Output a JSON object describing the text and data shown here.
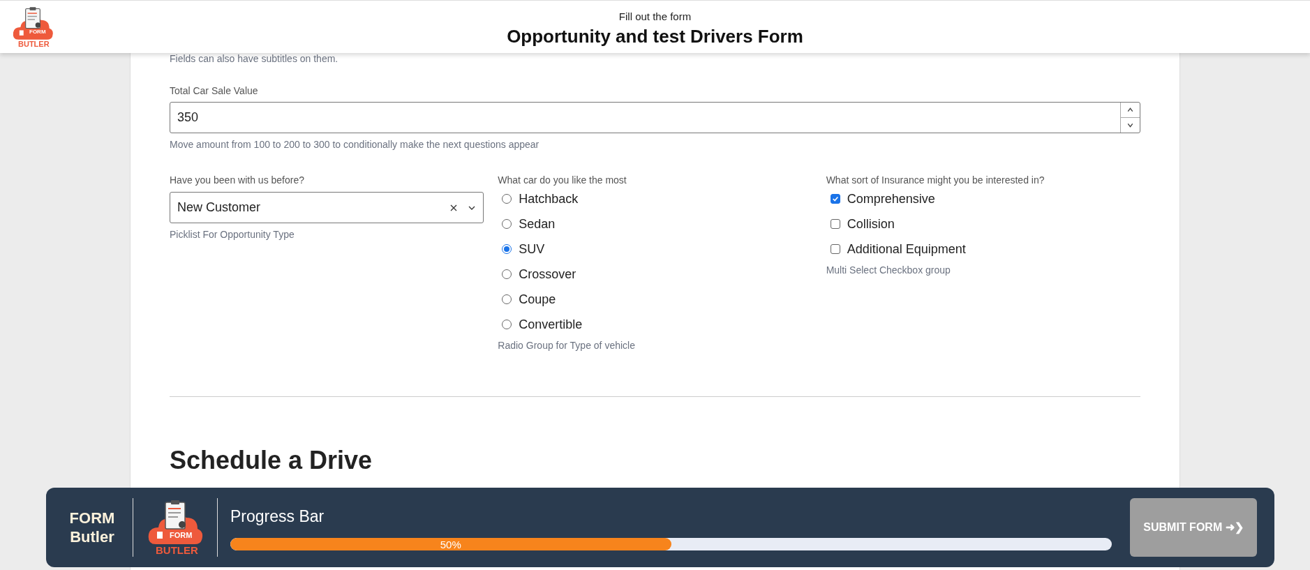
{
  "header": {
    "logo": {
      "word_top": "FORM",
      "word_bottom": "BUTLER"
    },
    "subtitle": "Fill out the form",
    "title": "Opportunity and test Drivers Form"
  },
  "form": {
    "intro_note": "Fields can also have subtitles on them.",
    "sale_value": {
      "label": "Total Car Sale Value",
      "value": "350",
      "help": "Move amount from 100 to 200 to 300 to conditionally make the next questions appear"
    },
    "customer": {
      "label": "Have you been with us before?",
      "value": "New Customer",
      "help": "Picklist For Opportunity Type"
    },
    "car": {
      "label": "What car do you like the most",
      "help": "Radio Group for Type of vehicle",
      "options": [
        {
          "label": "Hatchback",
          "selected": false
        },
        {
          "label": "Sedan",
          "selected": false
        },
        {
          "label": "SUV",
          "selected": true
        },
        {
          "label": "Crossover",
          "selected": false
        },
        {
          "label": "Coupe",
          "selected": false
        },
        {
          "label": "Convertible",
          "selected": false
        }
      ]
    },
    "insurance": {
      "label": "What sort of Insurance might you be interested in?",
      "help": "Multi Select Checkbox group",
      "options": [
        {
          "label": "Comprehensive",
          "checked": true
        },
        {
          "label": "Collision",
          "checked": false
        },
        {
          "label": "Additional Equipment",
          "checked": false
        }
      ]
    },
    "section_title": "Schedule a Drive"
  },
  "footer_bar": {
    "brand_top": "FORM",
    "brand_bottom": "Butler",
    "logo": {
      "word_top": "FORM",
      "word_bottom": "BUTLER"
    },
    "progress_title": "Progress Bar",
    "progress": {
      "level": 0.5,
      "reading": "50%"
    },
    "submit": {
      "label": "SUBMIT FORM ➜❯",
      "disabled": true
    }
  }
}
